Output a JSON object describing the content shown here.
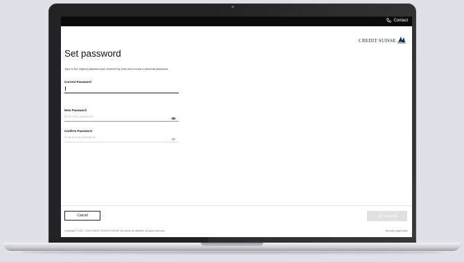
{
  "topbar": {
    "contact_label": "Contact",
    "contact_icon": "phone-icon"
  },
  "brand": {
    "logo_text": "CREDIT SUISSE",
    "color": "#0a2b57"
  },
  "page": {
    "title": "Set password",
    "intro": "Type in the original password you received by mail and choose a personal password."
  },
  "fields": {
    "current": {
      "label": "Current Password",
      "value": "",
      "placeholder": ""
    },
    "new": {
      "label": "New Password",
      "value": "",
      "placeholder": "Enter new password",
      "icon": "eye-icon"
    },
    "confirm": {
      "label": "Confirm Password",
      "value": "",
      "placeholder": "Repeat new password",
      "icon": "eye-icon"
    }
  },
  "actions": {
    "cancel_label": "Cancel",
    "submit_label": "Set password",
    "submit_color": "#e1e1e1"
  },
  "footer": {
    "copyright": "Copyright © 1997 - 2024 CREDIT SUISSE GROUP AG and/or its affiliates. All rights reserved.",
    "links": "Security   Legal Notes"
  }
}
